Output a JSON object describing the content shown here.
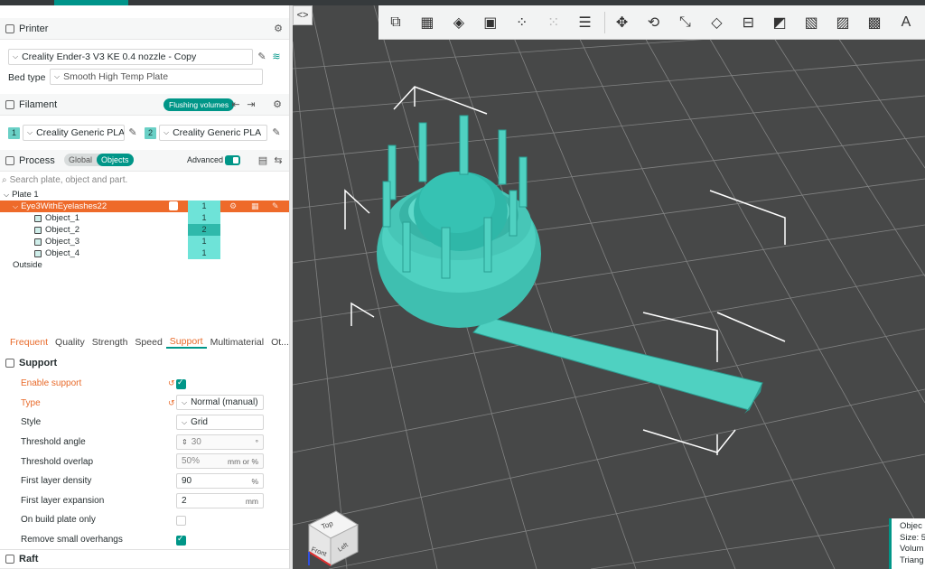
{
  "printer": {
    "title": "Printer",
    "name": "Creality Ender-3 V3 KE 0.4 nozzle - Copy",
    "bed_type_label": "Bed type",
    "bed_type_value": "Smooth High Temp Plate"
  },
  "filament": {
    "title": "Filament",
    "flushing_label": "Flushing volumes",
    "slots": [
      {
        "num": "1",
        "name": "Creality Generic PLA"
      },
      {
        "num": "2",
        "name": "Creality Generic PLA"
      }
    ]
  },
  "process": {
    "title": "Process",
    "toggle_global": "Global",
    "toggle_objects": "Objects",
    "advanced_label": "Advanced",
    "search_placeholder": "Search plate, object and part."
  },
  "tree": {
    "plate": "Plate 1",
    "object": {
      "name": "Eye3WithEyelashes22",
      "filament": "1"
    },
    "parts": [
      {
        "name": "Object_1",
        "filament": "1"
      },
      {
        "name": "Object_2",
        "filament": "2"
      },
      {
        "name": "Object_3",
        "filament": "1"
      },
      {
        "name": "Object_4",
        "filament": "1"
      }
    ],
    "outside": "Outside"
  },
  "tabs": [
    "Frequent",
    "Quality",
    "Strength",
    "Speed",
    "Support",
    "Multimaterial",
    "Ot..."
  ],
  "support": {
    "title": "Support",
    "enable_label": "Enable support",
    "type_label": "Type",
    "type_value": "Normal (manual)",
    "style_label": "Style",
    "style_value": "Grid",
    "threshold_angle_label": "Threshold angle",
    "threshold_angle_value": "30",
    "threshold_angle_unit": "°",
    "threshold_overlap_label": "Threshold overlap",
    "threshold_overlap_value": "50%",
    "threshold_overlap_unit": "mm or %",
    "first_layer_density_label": "First layer density",
    "first_layer_density_value": "90",
    "first_layer_density_unit": "%",
    "first_layer_expansion_label": "First layer expansion",
    "first_layer_expansion_value": "2",
    "first_layer_expansion_unit": "mm",
    "build_plate_only_label": "On build plate only",
    "remove_overhangs_label": "Remove small overhangs"
  },
  "raft": {
    "title": "Raft"
  },
  "viewport": {
    "collapse_icon": "<>",
    "view_cube_top": "Top",
    "view_cube_front": "Front",
    "view_cube_left": "Left",
    "info_lines": [
      "Objec",
      "Size: 5",
      "Volum",
      "Triang"
    ]
  },
  "colors": {
    "accent": "#009688",
    "model": "#4fd1c1",
    "selection": "#ee6a2a",
    "bed": "#474848"
  }
}
